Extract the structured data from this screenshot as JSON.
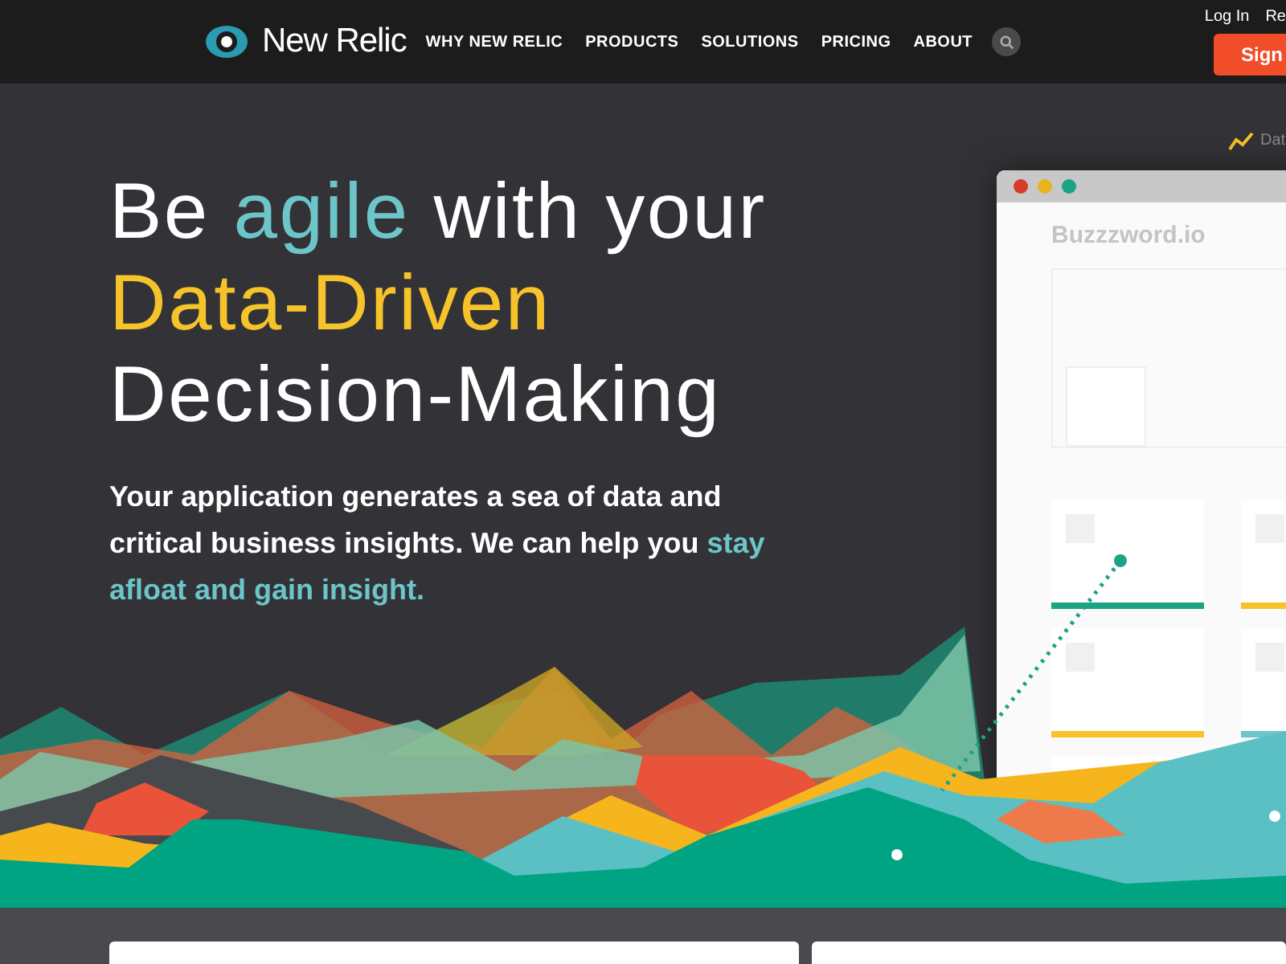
{
  "header": {
    "logo": "New Relic",
    "nav": [
      {
        "label": "WHY NEW RELIC"
      },
      {
        "label": "PRODUCTS"
      },
      {
        "label": "SOLUTIONS"
      },
      {
        "label": "PRICING"
      },
      {
        "label": "ABOUT"
      }
    ],
    "top_links": [
      "Log In",
      "Re"
    ],
    "signup_button": "Sign"
  },
  "hero": {
    "heading_lines": [
      [
        {
          "text": "Be ",
          "color": "#ffffff"
        },
        {
          "text": "agile",
          "color": "#6cc5c9"
        },
        {
          "text": " with your",
          "color": "#ffffff"
        }
      ],
      [
        {
          "text": "Data-Driven",
          "color": "#f6c32b"
        }
      ],
      [
        {
          "text": "Decision-Making",
          "color": "#ffffff"
        }
      ]
    ],
    "intro": [
      {
        "text": "Your application generates a sea of data and critical business insights. We can help you ",
        "color": "#ffffff"
      },
      {
        "text": "stay afloat and gain insight.",
        "color": "#6cc5c9"
      }
    ],
    "legend_label": "Dat",
    "mock_window": {
      "title": "Buzzzword.io"
    }
  }
}
